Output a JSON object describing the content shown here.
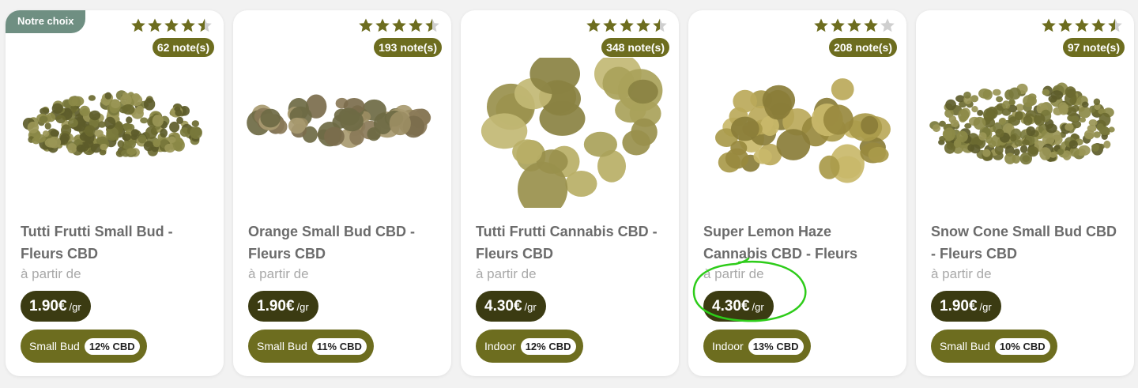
{
  "badge": {
    "label": "Notre choix"
  },
  "from_label": "à partir de",
  "unit": "/gr",
  "colors": {
    "ribbon": "#6f8f82",
    "olive": "#6d6d1f",
    "price_bg": "#3b3b12",
    "star": "#6d6d1f",
    "star_empty": "#cfcfcf",
    "highlight": "#2ecc1a"
  },
  "products": [
    {
      "name": "Tutti Frutti Small Bud - Fleurs CBD",
      "rating": 4.5,
      "notes": "62 note(s)",
      "price": "1.90€",
      "type": "Small Bud",
      "cbd": "12% CBD",
      "image": "pile-small-buds-icon"
    },
    {
      "name": "Orange Small Bud CBD - Fleurs CBD",
      "rating": 4.5,
      "notes": "193 note(s)",
      "price": "1.90€",
      "type": "Small Bud",
      "cbd": "11% CBD",
      "image": "scattered-buds-icon"
    },
    {
      "name": "Tutti Frutti Cannabis CBD - Fleurs CBD",
      "rating": 4.5,
      "notes": "348 note(s)",
      "price": "4.30€",
      "type": "Indoor",
      "cbd": "12% CBD",
      "image": "large-buds-icon"
    },
    {
      "name": "Super Lemon Haze Cannabis CBD - Fleurs",
      "rating": 4,
      "notes": "208 note(s)",
      "price": "4.30€",
      "type": "Indoor",
      "cbd": "13% CBD",
      "image": "lemon-buds-icon"
    },
    {
      "name": "Snow Cone Small Bud CBD - Fleurs CBD",
      "rating": 4.5,
      "notes": "97 note(s)",
      "price": "1.90€",
      "type": "Small Bud",
      "cbd": "10% CBD",
      "image": "pile-small-buds-icon"
    }
  ]
}
